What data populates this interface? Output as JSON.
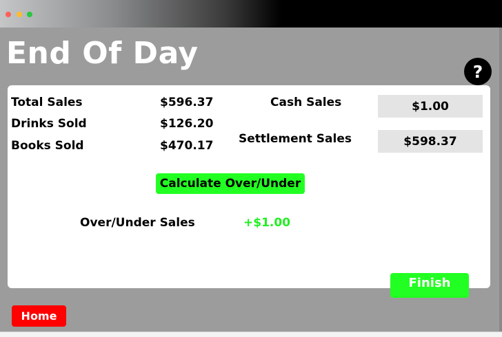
{
  "window": {
    "controls": [
      "close-dot",
      "minimize-dot",
      "maximize-dot"
    ],
    "control_colors": [
      "#ff5f57",
      "#febc2e",
      "#28c840"
    ]
  },
  "header": {
    "title": "End Of Day",
    "help_label": "?"
  },
  "summary": {
    "total_sales_label": "Total Sales",
    "total_sales_value": "$596.37",
    "drinks_sold_label": "Drinks Sold",
    "drinks_sold_value": "$126.20",
    "books_sold_label": "Books Sold",
    "books_sold_value": "$470.17"
  },
  "inputs": {
    "cash_sales_label": "Cash Sales",
    "cash_sales_value": "$1.00",
    "settlement_sales_label": "Settlement Sales",
    "settlement_sales_value": "$598.37"
  },
  "actions": {
    "calculate_label": "Calculate Over/Under",
    "finish_label": "Finish",
    "home_label": "Home"
  },
  "result": {
    "over_under_label": "Over/Under Sales",
    "over_under_value": "+$1.00"
  },
  "colors": {
    "app_background": "#9c9c9c",
    "action_green": "#22ff22",
    "home_red": "#ff0000",
    "result_green": "#22ee22"
  }
}
